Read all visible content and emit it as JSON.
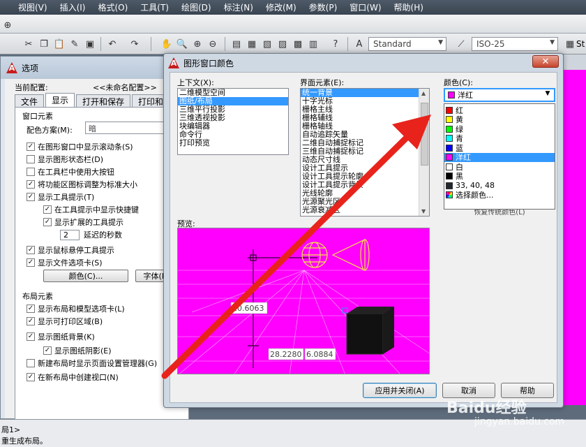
{
  "menu": [
    "视图(V)",
    "插入(I)",
    "格式(O)",
    "工具(T)",
    "绘图(D)",
    "标注(N)",
    "修改(M)",
    "参数(P)",
    "窗口(W)",
    "帮助(H)"
  ],
  "toolbar": {
    "text_style": "Standard",
    "dim_style": "ISO-25",
    "partial_label": "St"
  },
  "options_dialog": {
    "title": "选项",
    "profile_label": "当前配置:",
    "profile_value": "<<未命名配置>>",
    "tabs": [
      "文件",
      "显示",
      "打开和保存",
      "打印和发"
    ],
    "active_tab": "显示",
    "window_elements": {
      "group_label": "窗口元素",
      "scheme_label": "配色方案(M):",
      "scheme_value": "暗",
      "items": [
        {
          "label": "在图形窗口中显示滚动条(S)",
          "checked": true
        },
        {
          "label": "显示图形状态栏(D)",
          "checked": false
        },
        {
          "label": "在工具栏中使用大按钮",
          "checked": false
        },
        {
          "label": "将功能区图标调整为标准大小",
          "checked": true
        },
        {
          "label": "显示工具提示(T)",
          "checked": true
        },
        {
          "label": "在工具提示中显示快捷键",
          "checked": true
        },
        {
          "label": "显示扩展的工具提示",
          "checked": true
        }
      ],
      "delay_value": "2",
      "delay_label": "延迟的秒数",
      "items2": [
        {
          "label": "显示鼠标悬停工具提示",
          "checked": true
        },
        {
          "label": "显示文件选项卡(S)",
          "checked": true
        }
      ],
      "colors_button": "颜色(C)...",
      "fonts_button": "字体(F)"
    },
    "layout_elements": {
      "group_label": "布局元素",
      "items": [
        {
          "label": "显示布局和模型选项卡(L)",
          "checked": true
        },
        {
          "label": "显示可打印区域(B)",
          "checked": true
        },
        {
          "label": "显示图纸背景(K)",
          "checked": true
        },
        {
          "label": "显示图纸阴影(E)",
          "checked": true
        },
        {
          "label": "新建布局时显示页面设置管理器(G)",
          "checked": false
        },
        {
          "label": "在新布局中创建视口(N)",
          "checked": true
        }
      ]
    }
  },
  "color_dialog": {
    "title": "图形窗口颜色",
    "context_label": "上下文(X):",
    "context_items": [
      "二维模型空间",
      "图纸/布局",
      "三维平行投影",
      "三维透视投影",
      "块编辑器",
      "命令行",
      "打印预览"
    ],
    "context_selected": 1,
    "element_label": "界面元素(E):",
    "element_items": [
      "统一背景",
      "十字光标",
      "栅格主线",
      "栅格辅线",
      "栅格轴线",
      "自动追踪矢量",
      "二维自动捕捉标记",
      "三维自动捕捉标记",
      "动态尺寸线",
      "设计工具提示",
      "设计工具提示轮廓",
      "设计工具提示背景",
      "光线轮廓",
      "光源聚光区",
      "光源衰减区"
    ],
    "element_selected": 0,
    "color_label": "颜色(C):",
    "color_value": "洋红",
    "color_value_hex": "#ff00ff",
    "color_options": [
      {
        "name": "红",
        "hex": "#ff0000"
      },
      {
        "name": "黄",
        "hex": "#ffff00"
      },
      {
        "name": "绿",
        "hex": "#00ff00"
      },
      {
        "name": "青",
        "hex": "#00ffff"
      },
      {
        "name": "蓝",
        "hex": "#0000ff"
      },
      {
        "name": "洋红",
        "hex": "#ff00ff"
      },
      {
        "name": "白",
        "hex": "#ffffff"
      },
      {
        "name": "黑",
        "hex": "#000000"
      },
      {
        "name": "33, 40, 48",
        "hex": "#212830"
      },
      {
        "name": "选择颜色...",
        "hex": "multicolor"
      }
    ],
    "color_selected": 5,
    "restore_button": "恢复传统颜色(L)",
    "preview_label": "预览:",
    "preview_values": {
      "dim_vertical": "10.6063",
      "dim_x": "28.2280",
      "dim_y": "6.0884"
    },
    "apply_button": "应用并关闭(A)",
    "cancel_button": "取消",
    "help_button": "帮助"
  },
  "command_line": [
    "局1>",
    "重生成布局。"
  ],
  "watermark": {
    "brand": "Baidu经验",
    "url": "jingyan.baidu.com"
  },
  "colors": {
    "accent": "#3399ff",
    "arrow": "#e8231b",
    "preview_bg": "#ff00ff"
  }
}
